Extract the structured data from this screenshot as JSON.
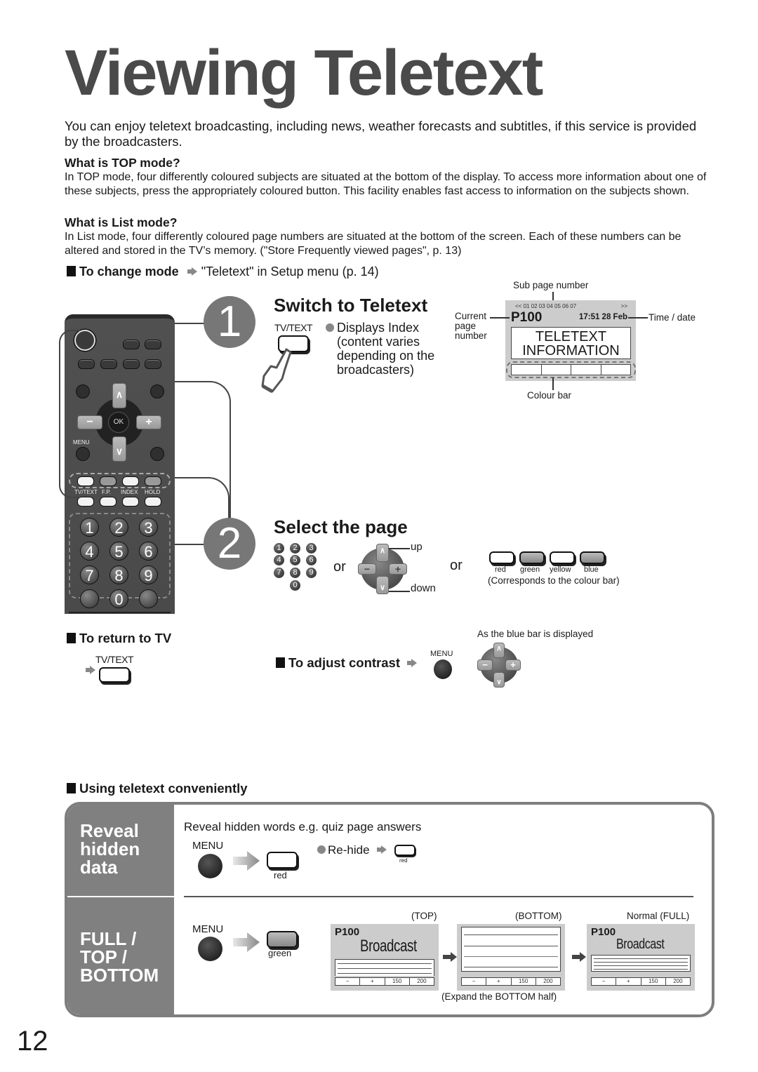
{
  "page": {
    "title": "Viewing Teletext",
    "intro": "You can enjoy teletext broadcasting, including news, weather forecasts and subtitles, if this service is provided by the broadcasters.",
    "page_number": "12"
  },
  "top_mode": {
    "heading": "What is TOP mode?",
    "text": "In TOP mode, four differently coloured subjects are situated at the bottom of the display. To access more information about one of these subjects, press the appropriately coloured button. This facility enables fast access to information on the subjects shown."
  },
  "list_mode": {
    "heading": "What is List mode?",
    "text": "In List mode, four differently coloured page numbers are situated at the bottom of the screen. Each of these numbers can be altered and stored in the TV’s memory. (\"Store Frequently viewed pages\", p. 13)"
  },
  "change_mode": {
    "label": "To change mode",
    "target": "\"Teletext\" in Setup menu (p. 14)"
  },
  "remote": {
    "ok_label": "OK",
    "menu_label": "MENU",
    "minus": "−",
    "plus": "+",
    "up": "∧",
    "down": "∨",
    "text_row_labels": [
      "TV/TEXT",
      "F.P.",
      "INDEX",
      "HOLD"
    ],
    "digits": [
      "1",
      "2",
      "3",
      "4",
      "5",
      "6",
      "7",
      "8",
      "9",
      "0"
    ]
  },
  "step1": {
    "number": "1",
    "title": "Switch to Teletext",
    "button_label": "TV/TEXT",
    "note_lines": [
      "Displays Index",
      "(content varies",
      "depending on the",
      "broadcasters)"
    ]
  },
  "teletext_screen": {
    "sub_page_label": "Sub page number",
    "sub_pages": "<< 01 02 03 04 05 06 07",
    "sub_next": ">>",
    "current_page_label_lines": [
      "Current",
      "page",
      "number"
    ],
    "page": "P100",
    "time_date": "17:51 28 Feb",
    "time_date_label": "Time / date",
    "body_lines": [
      "TELETEXT",
      "INFORMATION"
    ],
    "colour_bar_label": "Colour bar"
  },
  "step2": {
    "number": "2",
    "title": "Select the page",
    "digits": [
      "1",
      "2",
      "3",
      "4",
      "5",
      "6",
      "7",
      "8",
      "9",
      "0"
    ],
    "or1": "or",
    "or2": "or",
    "up_label": "up",
    "down_label": "down",
    "colour_buttons": [
      "red",
      "green",
      "yellow",
      "blue"
    ],
    "colour_note": "(Corresponds to the colour bar)"
  },
  "return_tv": {
    "label": "To return to TV",
    "button_label": "TV/TEXT"
  },
  "contrast": {
    "label": "To adjust contrast",
    "menu_label": "MENU",
    "note": "As the blue bar is displayed"
  },
  "convenient": {
    "heading": "Using teletext conveniently",
    "reveal": {
      "side_lines": [
        "Reveal",
        "hidden",
        "data"
      ],
      "description": "Reveal hidden words e.g. quiz page answers",
      "menu_label": "MENU",
      "button_label": "red",
      "rehide_label": "Re-hide",
      "rehide_button_label": "red"
    },
    "full": {
      "side_lines": [
        "FULL /",
        "TOP /",
        "BOTTOM"
      ],
      "menu_label": "MENU",
      "button_label": "green",
      "screens": [
        {
          "caption": "(TOP)",
          "page": "P100",
          "headline": "Broadcast"
        },
        {
          "caption": "(BOTTOM)",
          "page": "",
          "headline": ""
        },
        {
          "caption": "Normal (FULL)",
          "page": "P100",
          "headline": "Broadcast"
        }
      ],
      "bar_cells": [
        "−",
        "+",
        "150",
        "200"
      ],
      "expand_note": "(Expand the BOTTOM half)"
    }
  }
}
